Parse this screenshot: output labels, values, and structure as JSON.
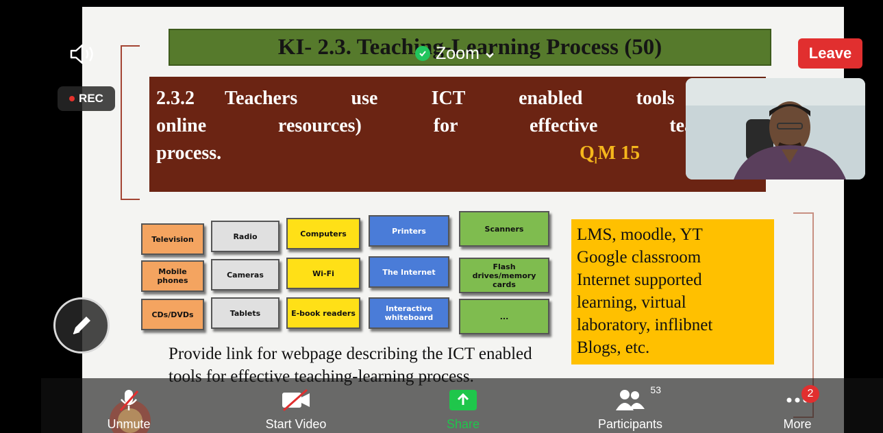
{
  "app": {
    "title": "Zoom",
    "leave_label": "Leave",
    "rec_label": "REC"
  },
  "slide": {
    "title": "KI- 2.3. Teaching-Learning Process (50)",
    "heading": {
      "line1_a": "2.3.2",
      "line1_b": "Teachers use ICT enabled tools (inc",
      "line2": "online resources) for effective teaching-le",
      "line3": "process.",
      "qm_q": "Q",
      "qm_sub": "l",
      "qm_rest": "M 15"
    },
    "tools": [
      {
        "label": "Television",
        "color": "orange"
      },
      {
        "label": "Radio",
        "color": "gray"
      },
      {
        "label": "Computers",
        "color": "yellow"
      },
      {
        "label": "Printers",
        "color": "blue"
      },
      {
        "label": "Scanners",
        "color": "green"
      },
      {
        "label": "Mobile phones",
        "color": "orange"
      },
      {
        "label": "Cameras",
        "color": "gray"
      },
      {
        "label": "Wi-Fi",
        "color": "yellow"
      },
      {
        "label": "The Internet",
        "color": "blue"
      },
      {
        "label": "Flash drives/memory cards",
        "color": "green"
      },
      {
        "label": "CDs/DVDs",
        "color": "orange"
      },
      {
        "label": "Tablets",
        "color": "gray"
      },
      {
        "label": "E-book readers",
        "color": "yellow"
      },
      {
        "label": "Interactive whiteboard",
        "color": "blue"
      },
      {
        "label": "...",
        "color": "green"
      }
    ],
    "yellow_box": [
      "LMS, moodle, YT",
      "Google classroom",
      "Internet supported",
      "learning, virtual",
      "laboratory, inflibnet",
      "Blogs, etc."
    ],
    "provide_text": "Provide link for webpage describing the ICT enabled tools for effective teaching-learning process."
  },
  "toolbar": {
    "unmute": "Unmute",
    "start_video": "Start Video",
    "share": "Share",
    "participants": "Participants",
    "participants_count": "53",
    "more": "More",
    "more_badge": "2"
  },
  "colors": {
    "leave": "#e12f2f",
    "share": "#1fc64b",
    "slide_heading_bg": "#6b2413",
    "title_bar": "#567a2c"
  }
}
